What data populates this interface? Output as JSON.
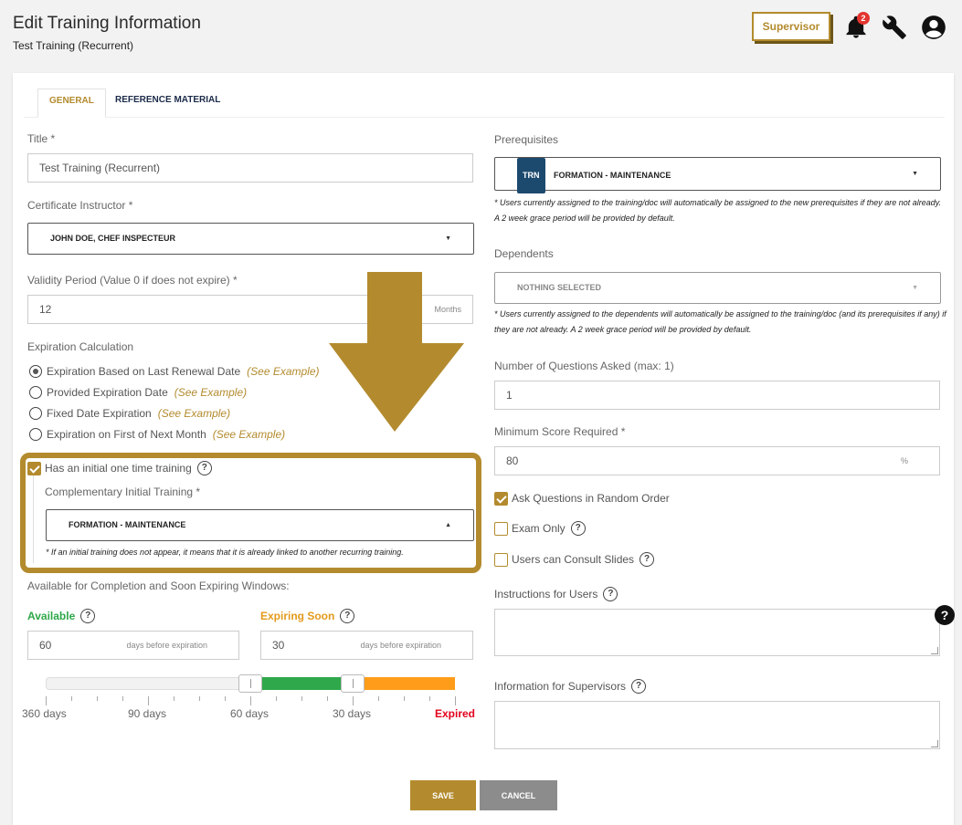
{
  "header": {
    "title": "Edit Training Information",
    "subtitle": "Test Training (Recurrent)",
    "role_label": "Supervisor",
    "notification_count": "2",
    "icons": [
      "bell-icon",
      "wrench-icon",
      "user-circle-icon"
    ],
    "accent_color": "#b38b2e"
  },
  "tabs": [
    {
      "label": "GENERAL",
      "active": true
    },
    {
      "label": "REFERENCE MATERIAL",
      "active": false
    }
  ],
  "left": {
    "title_label": "Title *",
    "title_value": "Test Training (Recurrent)",
    "instructor_label": "Certificate Instructor *",
    "instructor_value": "JOHN DOE, CHEF INSPECTEUR",
    "validity_label": "Validity Period (Value 0 if does not expire) *",
    "validity_value": "12",
    "validity_suffix": "Months",
    "expiration_label": "Expiration Calculation",
    "expiration_options": [
      {
        "label": "Expiration Based on Last Renewal Date",
        "example": "(See Example)",
        "selected": true
      },
      {
        "label": "Provided Expiration Date",
        "example": "(See Example)",
        "selected": false
      },
      {
        "label": "Fixed Date Expiration",
        "example": "(See Example)",
        "selected": false
      },
      {
        "label": "Expiration on First of Next Month",
        "example": "(See Example)",
        "selected": false
      }
    ],
    "initial_training_label": "Has an initial one time training",
    "initial_training_checked": true,
    "complementary_label": "Complementary Initial Training *",
    "complementary_value": "FORMATION - MAINTENANCE",
    "complementary_note": "* If an initial training does not appear, it means that it is already linked to another recurring training.",
    "windows_label": "Available for Completion and Soon Expiring Windows:",
    "available_label": "Available",
    "available_value": "60",
    "available_suffix": "days before expiration",
    "expiring_label": "Expiring Soon",
    "expiring_value": "30",
    "expiring_suffix": "days before expiration",
    "slider_labels": [
      "360 days",
      "90 days",
      "60 days",
      "30 days",
      "Expired"
    ],
    "slider_colors": {
      "available": "#2ea84a",
      "expiring": "#ff9c1a",
      "expired": "#e3001b"
    }
  },
  "right": {
    "prereq_label": "Prerequisites",
    "prereq_tag": "TRN",
    "prereq_value": "FORMATION - MAINTENANCE",
    "prereq_note": "* Users currently assigned to the training/doc will automatically be assigned to the new prerequisites if they are not already. A 2 week grace period will be provided by default.",
    "dependents_label": "Dependents",
    "dependents_value": "NOTHING SELECTED",
    "dependents_note": "* Users currently assigned to the dependents will automatically be assigned to the training/doc (and its prerequisites if any) if they are not already. A 2 week grace period will be provided by default.",
    "questions_label": "Number of Questions Asked (max: 1)",
    "questions_value": "1",
    "min_score_label": "Minimum Score Required *",
    "min_score_value": "80",
    "min_score_suffix": "%",
    "random_order_label": "Ask Questions in Random Order",
    "random_order_checked": true,
    "exam_only_label": "Exam Only",
    "exam_only_checked": false,
    "consult_slides_label": "Users can Consult Slides",
    "consult_slides_checked": false,
    "instructions_label": "Instructions for Users",
    "supervisor_info_label": "Information for Supervisors"
  },
  "actions": {
    "save": "SAVE",
    "cancel": "CANCEL"
  },
  "help_glyph": "?"
}
